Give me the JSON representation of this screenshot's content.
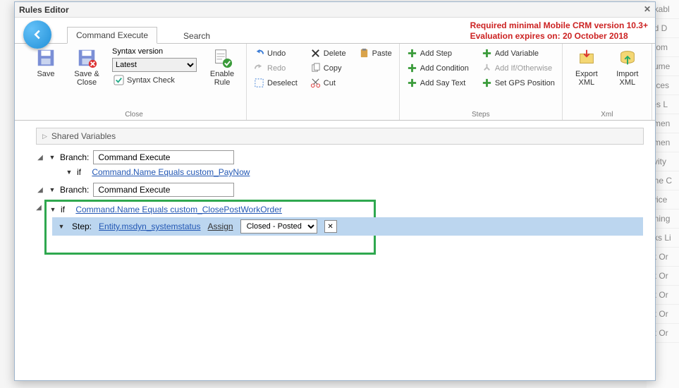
{
  "behind_items": [
    "okabl",
    "ud D",
    "stom",
    "cume",
    "oices",
    "tes L",
    "ymen",
    "ymen",
    "tivity",
    "one C",
    "rvice",
    "nning",
    "sks Li",
    "rk Or",
    "rk Or",
    "rk Or",
    "rk Or",
    "rk Or",
    ""
  ],
  "title": "Rules Editor",
  "closex": "✕",
  "warn_line1": "Required minimal Mobile CRM version 10.3+",
  "warn_line2": "Evaluation expires on: 20 October 2018",
  "tabs": {
    "command_execute": "Command Execute",
    "search": "Search"
  },
  "ribbon": {
    "save": "Save",
    "save_close": "Save & Close",
    "syntax_version_label": "Syntax version",
    "syntax_version_value": "Latest",
    "syntax_check": "Syntax Check",
    "enable_rule": "Enable Rule",
    "undo": "Undo",
    "redo": "Redo",
    "deselect": "Deselect",
    "delete": "Delete",
    "copy": "Copy",
    "cut": "Cut",
    "paste": "Paste",
    "add_step": "Add Step",
    "add_condition": "Add Condition",
    "add_say_text": "Add Say Text",
    "add_variable": "Add Variable",
    "add_if_otherwise": "Add If/Otherwise",
    "set_gps": "Set GPS Position",
    "export_xml": "Export XML",
    "import_xml": "Import XML",
    "group_close": "Close",
    "group_steps": "Steps",
    "group_xml": "Xml"
  },
  "content": {
    "shared_variables": "Shared Variables",
    "branch_label": "Branch:",
    "branch_value": "Command Execute",
    "if_label": "if",
    "cond1": "Command.Name Equals custom_PayNow",
    "cond2": "Command.Name Equals custom_ClosePostWorkOrder",
    "step_label": "Step:",
    "step_entity": "Entity.msdyn_systemstatus",
    "step_assign": "Assign",
    "step_value": "Closed - Posted"
  }
}
